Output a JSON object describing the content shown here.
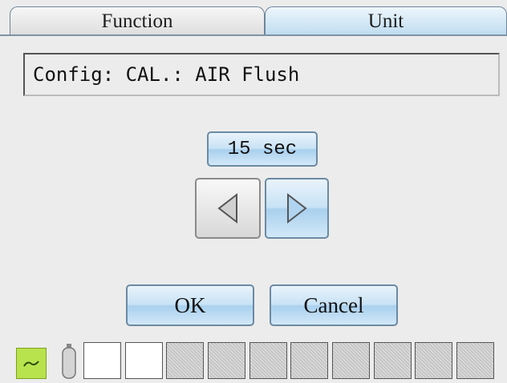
{
  "tabs": [
    {
      "label": "Function",
      "selected": true
    },
    {
      "label": "Unit",
      "selected": false
    }
  ],
  "config": {
    "text": "Config: CAL.: AIR Flush"
  },
  "value": {
    "text": "15 sec"
  },
  "controls": {
    "left_icon": "triangle-left-icon",
    "right_icon": "triangle-right-icon"
  },
  "actions": {
    "ok_label": "OK",
    "cancel_label": "Cancel"
  },
  "status": {
    "sd_icon": "sd-card-icon",
    "bottle_icon": "gas-cylinder-icon",
    "slots": [
      "empty",
      "empty",
      "disabled",
      "disabled",
      "disabled",
      "disabled",
      "disabled",
      "disabled",
      "disabled",
      "disabled"
    ]
  },
  "colors": {
    "accent": "#bedcf0",
    "border": "#6c8aa3",
    "sd_green": "#b8e34d"
  }
}
